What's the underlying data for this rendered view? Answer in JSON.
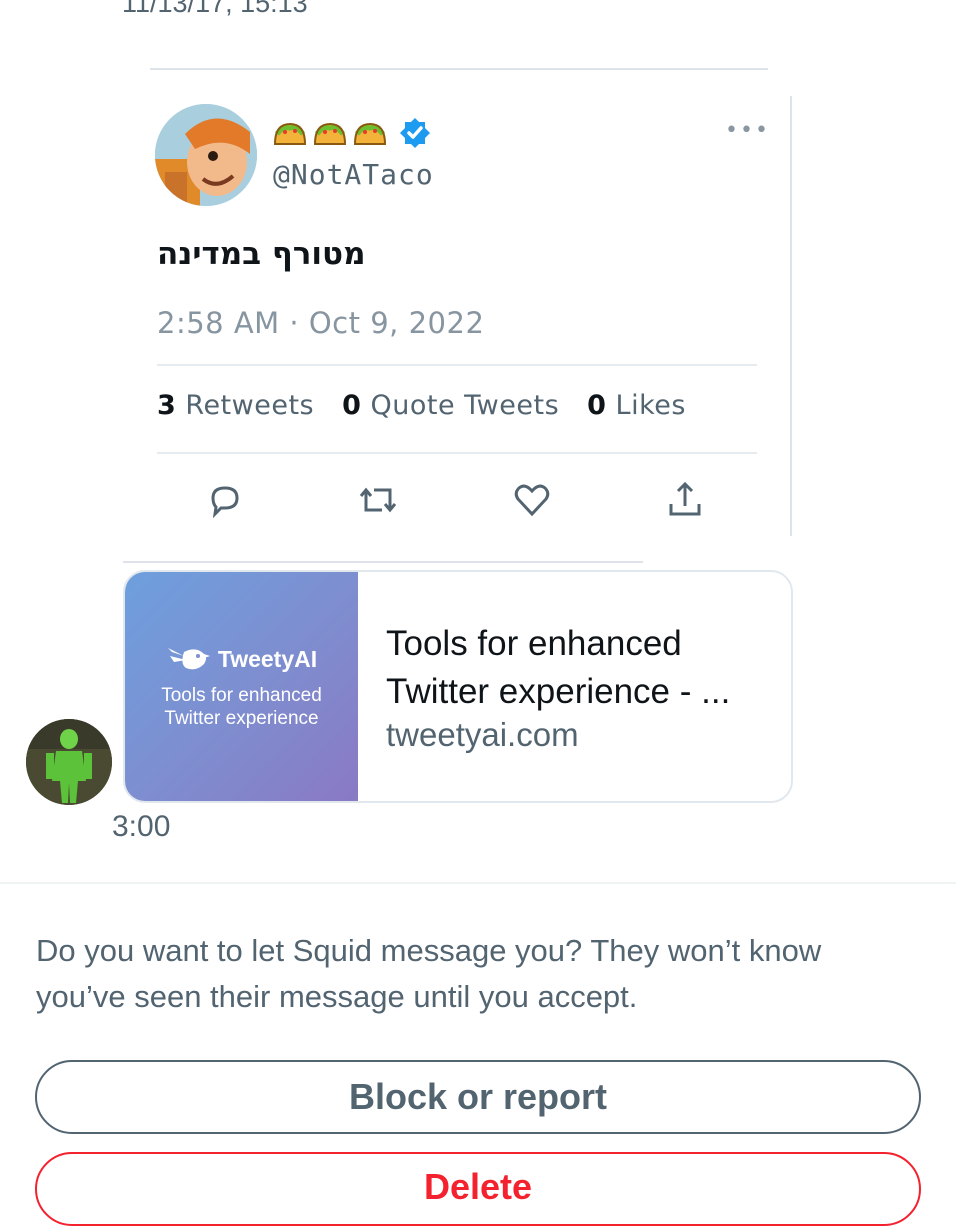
{
  "conversation": {
    "top_timestamp": "11/13/17, 15:13"
  },
  "quoted_tweet": {
    "display_name_emojis": [
      "taco",
      "taco",
      "taco"
    ],
    "verified": true,
    "handle": "@NotATaco",
    "more_label": "•••",
    "text": "מטורף במדינה",
    "time": "2:58 AM",
    "date": "Oct 9, 2022",
    "stats": {
      "retweets_count": "3",
      "retweets_label": "Retweets",
      "quotes_count": "0",
      "quotes_label": "Quote Tweets",
      "likes_count": "0",
      "likes_label": "Likes"
    },
    "actions": [
      "reply-icon",
      "retweet-icon",
      "like-icon",
      "share-icon"
    ]
  },
  "link_card": {
    "thumb_brand": "TweetyAI",
    "thumb_tagline_line1": "Tools for enhanced",
    "thumb_tagline_line2": "Twitter experience",
    "title_line1": "Tools for enhanced",
    "title_line2": "Twitter experience - ...",
    "domain": "tweetyai.com"
  },
  "message": {
    "time": "3:00"
  },
  "request": {
    "prompt": "Do you want to let Squid message you? They won’t know you’ve seen their message until you accept.",
    "block_label": "Block or report",
    "delete_label": "Delete"
  },
  "colors": {
    "secondary_text": "#536471",
    "verified_blue": "#1d9bf0",
    "danger": "#f4212e"
  }
}
